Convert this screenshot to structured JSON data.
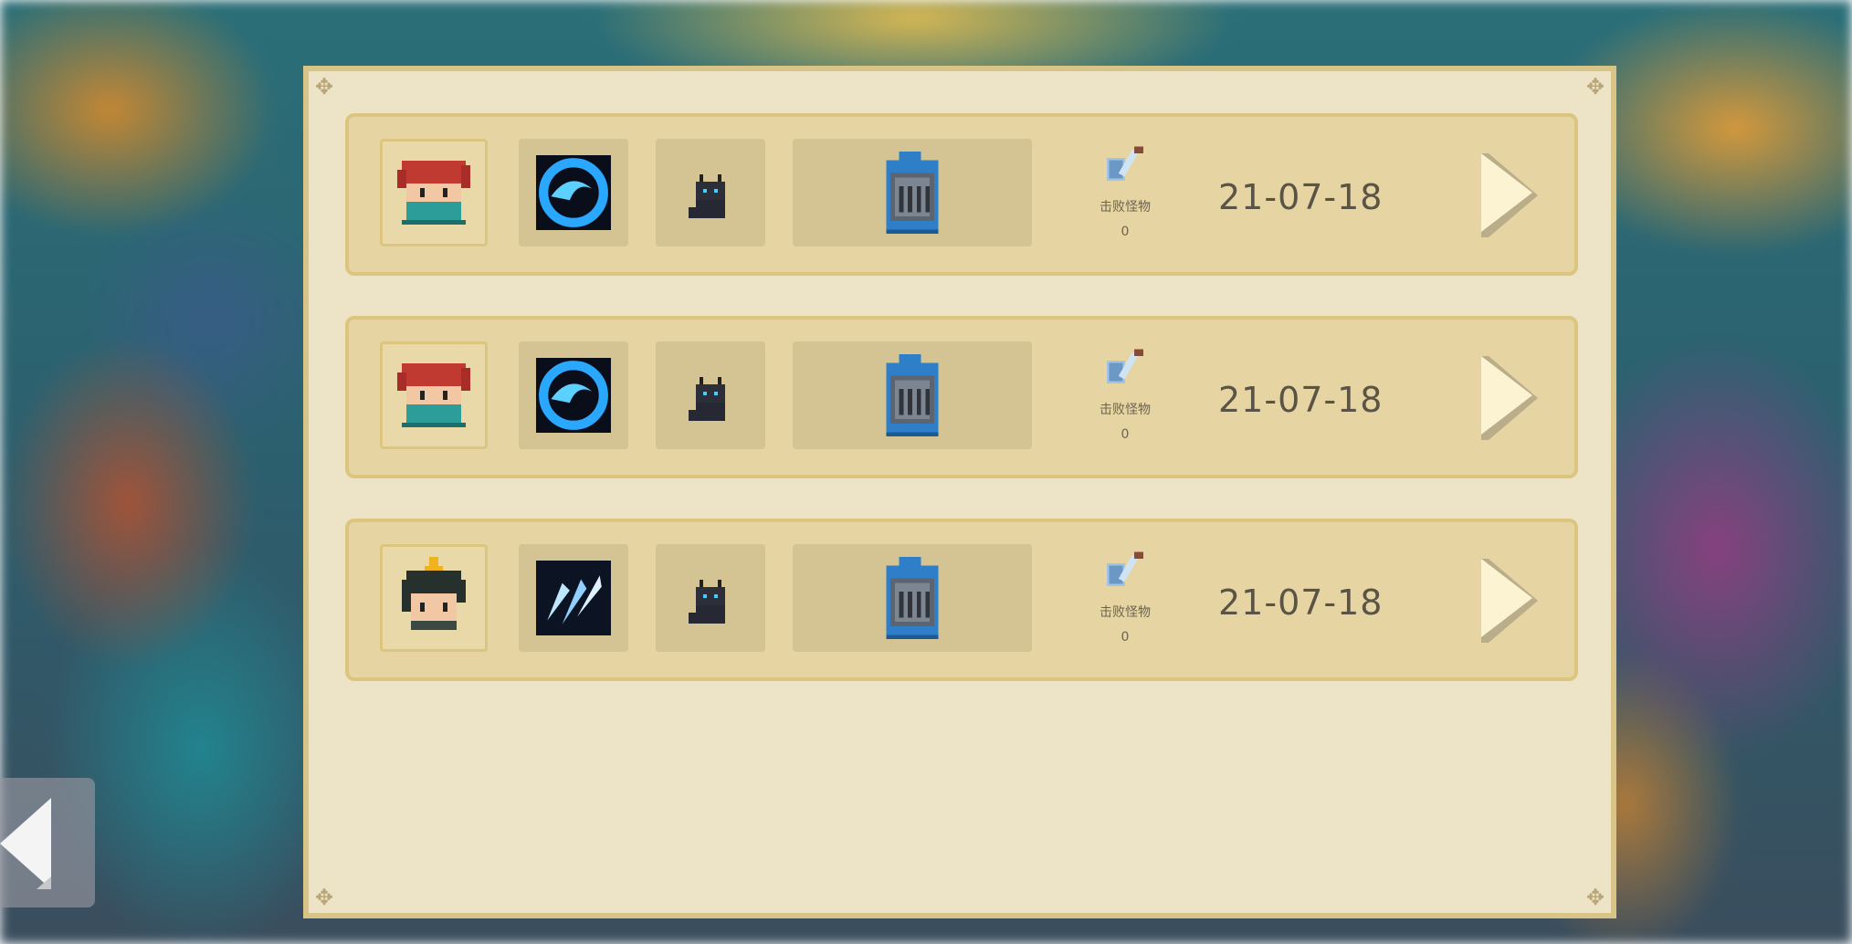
{
  "records": [
    {
      "character": "red-haired-masked-hero",
      "skill": "water-wave-skill",
      "pet": "black-cat",
      "helmet": "blue-knight-helmet",
      "kills_label": "击败怪物",
      "kills_count": "0",
      "date": "21-07-18"
    },
    {
      "character": "red-haired-masked-hero",
      "skill": "water-wave-skill",
      "pet": "black-cat",
      "helmet": "blue-knight-helmet",
      "kills_label": "击败怪物",
      "kills_count": "0",
      "date": "21-07-18"
    },
    {
      "character": "black-haired-crowned-hero",
      "skill": "ice-shards-skill",
      "pet": "black-cat",
      "helmet": "blue-knight-helmet",
      "kills_label": "击败怪物",
      "kills_count": "0",
      "date": "21-07-18"
    }
  ],
  "icons": {
    "next": "right-arrow-icon",
    "back": "left-arrow-icon",
    "kills": "sword-shield-icon"
  }
}
